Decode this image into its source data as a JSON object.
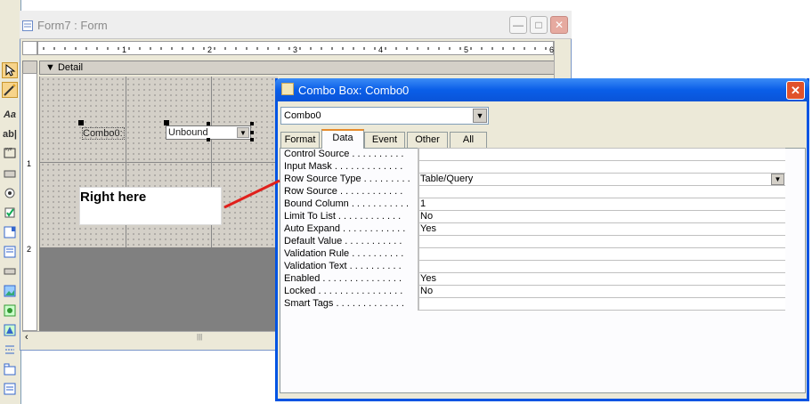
{
  "form_window": {
    "title": "Form7 : Form",
    "minimize": "—",
    "maximize": "□",
    "close": "✕",
    "detail_section": "Detail",
    "ruler_marks": [
      "1",
      "2",
      "3",
      "4",
      "5",
      "6"
    ],
    "vruler_marks": [
      "1",
      "2"
    ],
    "combo_label": "Combo0:",
    "combo_value": "Unbound",
    "callout_text": "Right here"
  },
  "toolbox": {
    "tools": [
      "select-pointer-icon",
      "control-wizard-icon",
      "label-icon",
      "textbox-icon",
      "option-group-icon",
      "toggle-icon",
      "option-button-icon",
      "checkbox-icon",
      "combobox-icon",
      "listbox-icon",
      "command-button-icon",
      "image-icon",
      "unbound-object-icon",
      "bound-object-icon",
      "page-break-icon",
      "tab-control-icon",
      "subform-icon"
    ],
    "labels": {
      "label": "Aa",
      "textbox": "ab|"
    }
  },
  "property_sheet": {
    "title": "Combo Box: Combo0",
    "selected_object": "Combo0",
    "tabs": [
      "Format",
      "Data",
      "Event",
      "Other",
      "All"
    ],
    "active_tab": "Data",
    "properties": [
      {
        "name": "Control Source . . . . . . . . . .",
        "value": ""
      },
      {
        "name": "Input Mask . . . . . . . . . . . . .",
        "value": ""
      },
      {
        "name": "Row Source Type . . . . . . . . .",
        "value": "Table/Query"
      },
      {
        "name": "Row Source . . . . . . . . . . . .",
        "value": ""
      },
      {
        "name": "Bound Column . . . . . . . . . . .",
        "value": "1"
      },
      {
        "name": "Limit To List . . . . . . . . . . . .",
        "value": "No"
      },
      {
        "name": "Auto Expand . . . . . . . . . . . .",
        "value": "Yes"
      },
      {
        "name": "Default Value . . . . . . . . . . .",
        "value": ""
      },
      {
        "name": "Validation Rule . . . . . . . . . .",
        "value": ""
      },
      {
        "name": "Validation Text . . . . . . . . . .",
        "value": ""
      },
      {
        "name": "Enabled . . . . . . . . . . . . . . .",
        "value": "Yes"
      },
      {
        "name": "Locked . . . . . . . . . . . . . . . .",
        "value": "No"
      },
      {
        "name": "Smart Tags . . . . . . . . . . . . .",
        "value": ""
      }
    ]
  },
  "colors": {
    "titlebar": "#0a5ee8",
    "annotation_arrow": "#e0201c",
    "active_tab_accent": "#e68b2c"
  }
}
